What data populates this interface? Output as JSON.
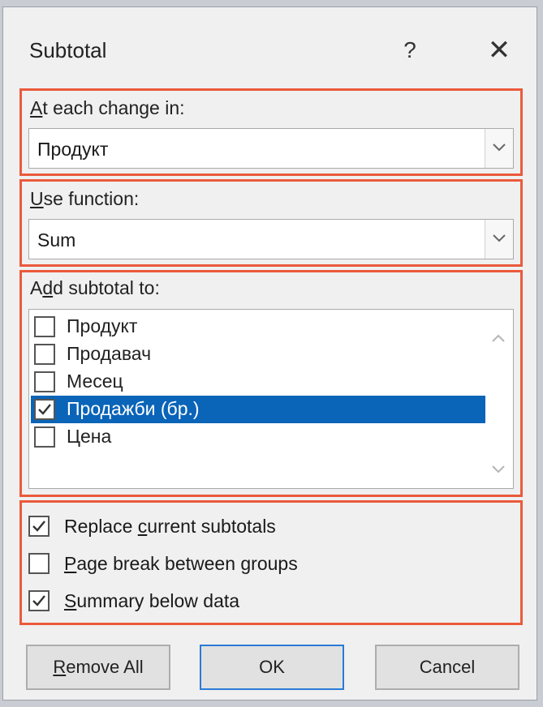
{
  "dialog": {
    "title": "Subtotal",
    "help_glyph": "?",
    "close_glyph": "✕"
  },
  "change_in": {
    "label_accel": "A",
    "label_rest": "t each change in:",
    "value": "Продукт"
  },
  "use_function": {
    "label_accel": "U",
    "label_rest": "se function:",
    "value": "Sum"
  },
  "add_subtotal": {
    "label_pre": "A",
    "label_accel": "d",
    "label_rest": "d subtotal to:",
    "items": [
      {
        "label": "Продукт",
        "checked": false,
        "selected": false
      },
      {
        "label": "Продавач",
        "checked": false,
        "selected": false
      },
      {
        "label": "Месец",
        "checked": false,
        "selected": false
      },
      {
        "label": "Продажби (бр.)",
        "checked": true,
        "selected": true
      },
      {
        "label": "Цена",
        "checked": false,
        "selected": false
      }
    ]
  },
  "options": {
    "replace_pre": "Replace ",
    "replace_accel": "c",
    "replace_rest": "urrent subtotals",
    "replace_checked": true,
    "pagebreak_accel": "P",
    "pagebreak_rest": "age break between groups",
    "pagebreak_checked": false,
    "summary_accel": "S",
    "summary_rest": "ummary below data",
    "summary_checked": true
  },
  "buttons": {
    "remove_accel": "R",
    "remove_rest": "emove All",
    "ok": "OK",
    "cancel": "Cancel"
  },
  "colors": {
    "highlight_border": "#ea5a3c",
    "selection": "#0a64b8",
    "default_button_border": "#2b7bd6"
  }
}
